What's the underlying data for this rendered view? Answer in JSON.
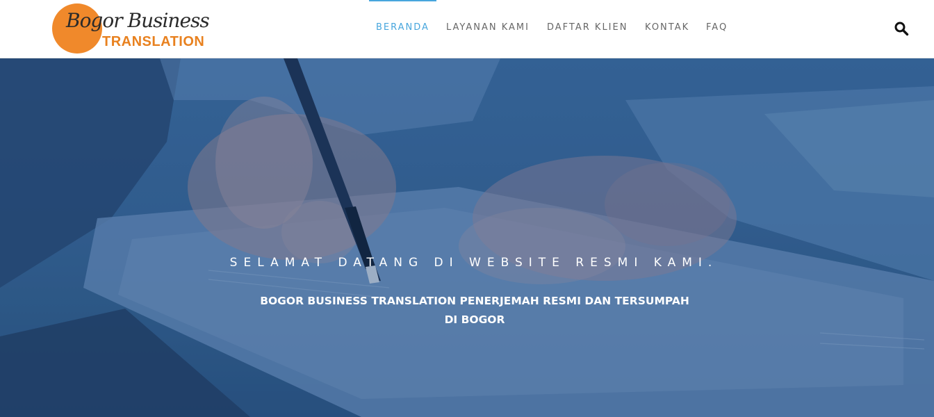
{
  "logo": {
    "line1": "Bogor Business",
    "line2": "TRANSLATION",
    "circle_color": "#f0892b",
    "accent_color": "#e8811f"
  },
  "nav": {
    "active_color": "#47a6dd",
    "items": [
      {
        "label": "BERANDA",
        "active": true
      },
      {
        "label": "LAYANAN KAMI",
        "active": false
      },
      {
        "label": "DAFTAR KLIEN",
        "active": false
      },
      {
        "label": "KONTAK",
        "active": false
      },
      {
        "label": "FAQ",
        "active": false
      }
    ],
    "search_icon": "search-icon"
  },
  "hero": {
    "subtitle": "SELAMAT DATANG DI WEBSITE RESMI KAMI.",
    "title_line1": "BOGOR BUSINESS TRANSLATION PENERJEMAH RESMI DAN TERSUMPAH",
    "title_line2": "DI BOGOR",
    "background_image": "hand-signing-document-photo",
    "overlay_color": "#184076"
  }
}
